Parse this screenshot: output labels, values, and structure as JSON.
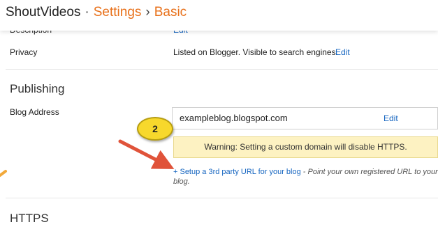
{
  "header": {
    "blog_name": "ShoutVideos",
    "separator1": "·",
    "section": "Settings",
    "separator2": "›",
    "page": "Basic"
  },
  "rows": {
    "description": {
      "label": "Description",
      "edit": "Edit"
    },
    "privacy": {
      "label": "Privacy",
      "value": "Listed on Blogger. Visible to search engines.",
      "edit": "Edit"
    }
  },
  "publishing": {
    "title": "Publishing",
    "blog_address_label": "Blog Address",
    "address": "exampleblog.blogspot.com",
    "address_edit": "Edit",
    "warning": "Warning: Setting a custom domain will disable HTTPS.",
    "setup_link": "+ Setup a 3rd party URL for your blog",
    "setup_desc": " - Point your own registered URL to your blog."
  },
  "https": {
    "title": "HTTPS"
  },
  "annotation": {
    "step_number": "2",
    "badge_color": "#f7d82c",
    "arrow_color": "#e0533a"
  },
  "colors": {
    "accent_orange": "#e8711b",
    "link_blue": "#1565c0",
    "warning_bg": "#fdf2c2"
  }
}
